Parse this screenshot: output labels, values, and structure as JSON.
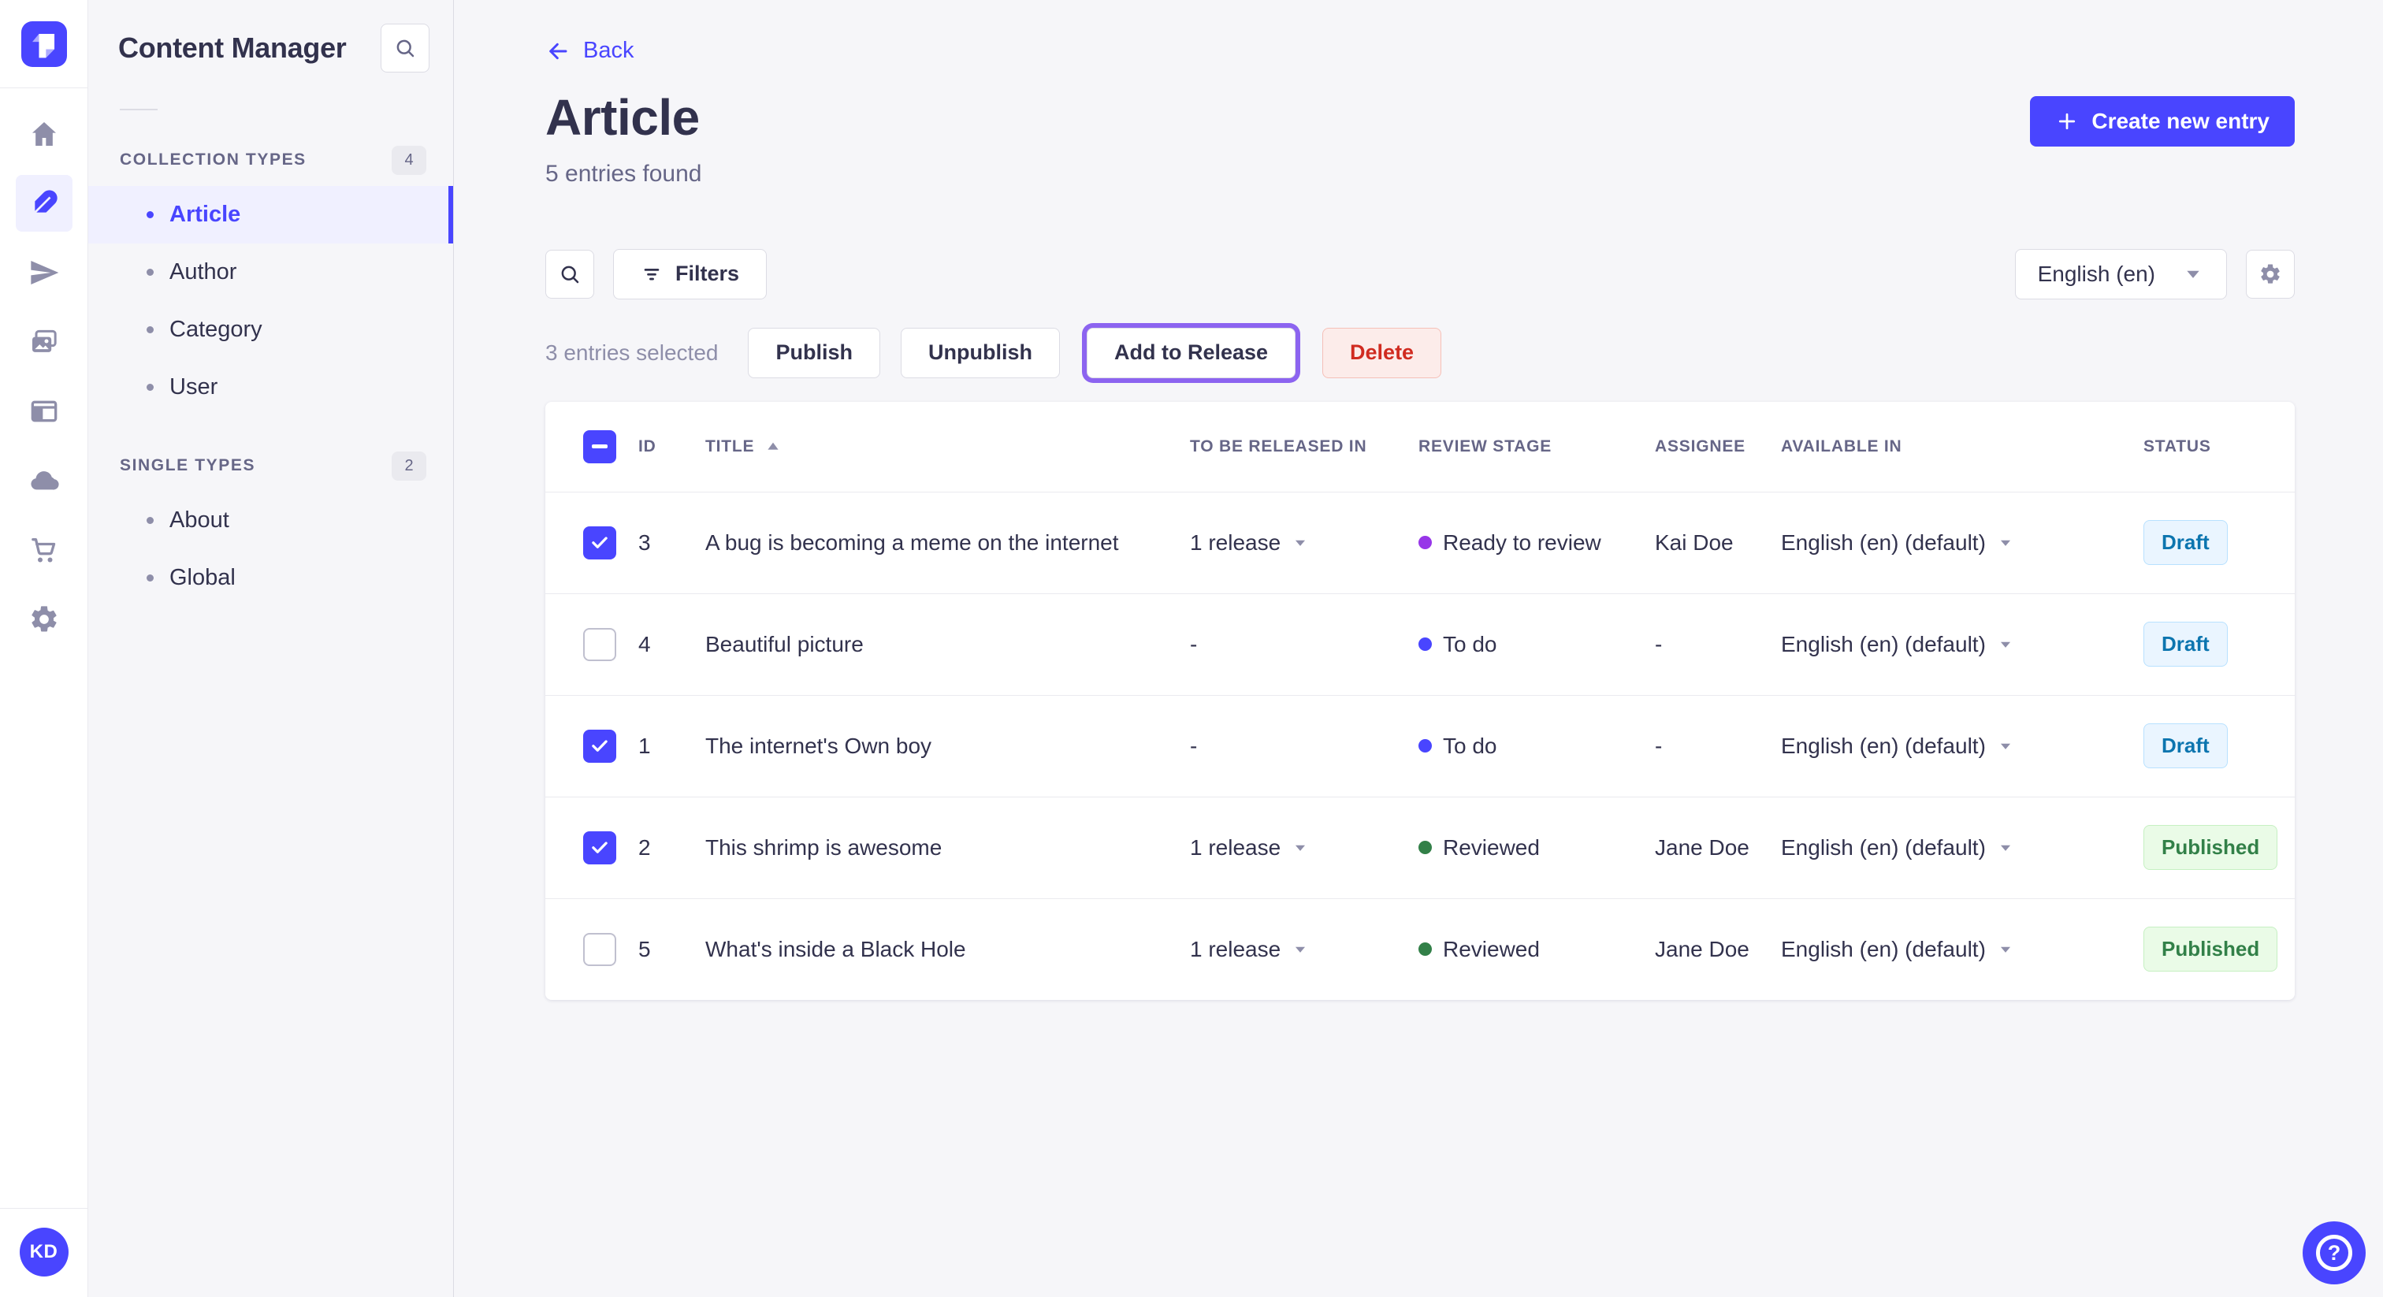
{
  "app": {
    "name": "Content Manager",
    "colors": {
      "accent": "#4945ff",
      "accent_light": "#f0f0ff",
      "danger": "#d02b20",
      "danger_light": "#fcecea",
      "release_highlight": "#8c64f0",
      "draft_text": "#0c75af",
      "published_text": "#328048"
    },
    "icons": {
      "logo": "strapi-logo",
      "rail": [
        "home-icon",
        "feather-icon",
        "send-icon",
        "media-icon",
        "layout-icon",
        "cloud-icon",
        "cart-icon",
        "gear-icon"
      ],
      "misc": [
        "search-icon",
        "filter-icon",
        "chevron-down-icon",
        "sort-asc-icon",
        "plus-icon",
        "arrow-left-icon",
        "question-icon",
        "check-icon",
        "minus-icon"
      ]
    }
  },
  "subnav": {
    "title": "Content Manager",
    "sections": [
      {
        "label": "COLLECTION TYPES",
        "count": "4",
        "items": [
          {
            "label": "Article",
            "active": true
          },
          {
            "label": "Author",
            "active": false
          },
          {
            "label": "Category",
            "active": false
          },
          {
            "label": "User",
            "active": false
          }
        ]
      },
      {
        "label": "SINGLE TYPES",
        "count": "2",
        "items": [
          {
            "label": "About",
            "active": false
          },
          {
            "label": "Global",
            "active": false
          }
        ]
      }
    ]
  },
  "header": {
    "back_label": "Back",
    "title": "Article",
    "subtitle": "5 entries found",
    "create_button": "Create new entry"
  },
  "toolbar": {
    "filters_label": "Filters",
    "locale": "English (en)"
  },
  "selection": {
    "text": "3 entries selected",
    "publish": "Publish",
    "unpublish": "Unpublish",
    "add_to_release": "Add to Release",
    "delete": "Delete"
  },
  "table": {
    "headers": [
      "ID",
      "TITLE",
      "TO BE RELEASED IN",
      "REVIEW STAGE",
      "ASSIGNEE",
      "AVAILABLE IN",
      "STATUS"
    ],
    "select_all_state": "indeterminate",
    "sorted_by": "TITLE ascending",
    "rows": [
      {
        "checked": true,
        "id": "3",
        "title": "A bug is becoming a meme on the internet",
        "release": "1 release",
        "release_caret": true,
        "stage": "Ready to review",
        "stage_color": "#9736e8",
        "assignee": "Kai Doe",
        "locale": "English (en) (default)",
        "status": "Draft",
        "status_type": "draft"
      },
      {
        "checked": false,
        "id": "4",
        "title": "Beautiful picture",
        "release": "-",
        "release_caret": false,
        "stage": "To do",
        "stage_color": "#4945ff",
        "assignee": "-",
        "locale": "English (en) (default)",
        "status": "Draft",
        "status_type": "draft"
      },
      {
        "checked": true,
        "id": "1",
        "title": "The internet's Own boy",
        "release": "-",
        "release_caret": false,
        "stage": "To do",
        "stage_color": "#4945ff",
        "assignee": "-",
        "locale": "English (en) (default)",
        "status": "Draft",
        "status_type": "draft"
      },
      {
        "checked": true,
        "id": "2",
        "title": "This shrimp is awesome",
        "release": "1 release",
        "release_caret": true,
        "stage": "Reviewed",
        "stage_color": "#328048",
        "assignee": "Jane Doe",
        "locale": "English (en) (default)",
        "status": "Published",
        "status_type": "published"
      },
      {
        "checked": false,
        "id": "5",
        "title": "What's inside a Black Hole",
        "release": "1 release",
        "release_caret": true,
        "stage": "Reviewed",
        "stage_color": "#328048",
        "assignee": "Jane Doe",
        "locale": "English (en) (default)",
        "status": "Published",
        "status_type": "published"
      }
    ]
  },
  "user": {
    "initials": "KD"
  }
}
